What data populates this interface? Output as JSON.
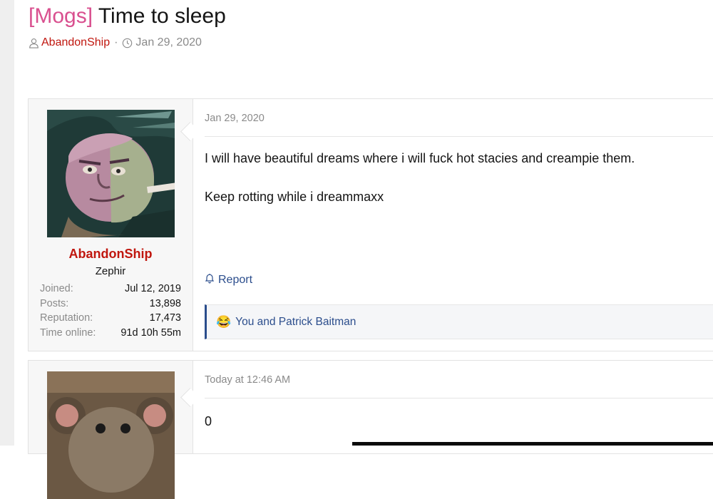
{
  "thread": {
    "prefix": "[Mogs]",
    "title": "Time to sleep",
    "author": "AbandonShip",
    "date": "Jan 29, 2020"
  },
  "posts": [
    {
      "date": "Jan 29, 2020",
      "user": {
        "name": "AbandonShip",
        "title": "Zephir",
        "stats": [
          {
            "label": "Joined:",
            "value": "Jul 12, 2019"
          },
          {
            "label": "Posts:",
            "value": "13,898"
          },
          {
            "label": "Reputation:",
            "value": "17,473"
          },
          {
            "label": "Time online:",
            "value": "91d 10h 55m"
          }
        ]
      },
      "body": [
        "I will have beautiful dreams where i will fuck hot stacies and creampie them.",
        "Keep rotting while i dreammaxx"
      ],
      "report_label": "Report",
      "reactions": {
        "icon": "crying-laughing-emoji",
        "emoji": "😂",
        "text": "You and Patrick Baitman"
      }
    },
    {
      "date": "Today at 12:46 AM",
      "body": [
        "0"
      ]
    }
  ],
  "colors": {
    "prefix": "#d9508f",
    "username": "#c0160e",
    "link": "#2b4d8c",
    "muted": "#8a8a8a"
  }
}
